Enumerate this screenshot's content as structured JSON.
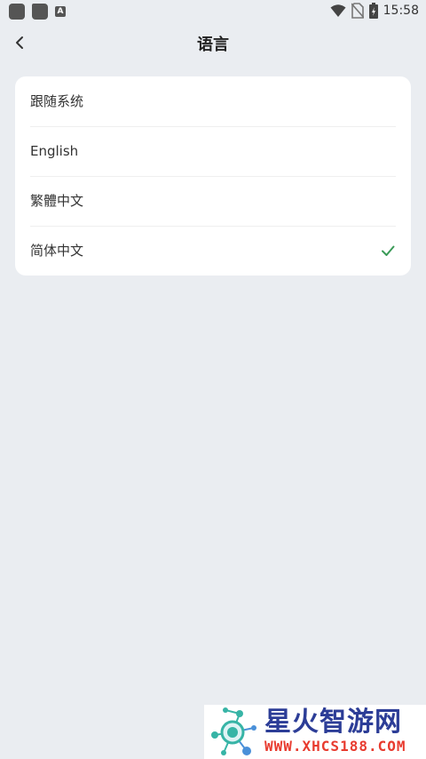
{
  "status_bar": {
    "time": "15:58",
    "left_icons": [
      "app-icon",
      "folder-icon",
      "a-icon"
    ],
    "right_icons": [
      "wifi-icon",
      "no-sim-icon",
      "battery-charging-icon"
    ]
  },
  "header": {
    "title": "语言",
    "back_icon": "chevron-left-icon"
  },
  "languages": [
    {
      "label": "跟随系统",
      "selected": false
    },
    {
      "label": "English",
      "selected": false
    },
    {
      "label": "繁體中文",
      "selected": false
    },
    {
      "label": "简体中文",
      "selected": true
    }
  ],
  "colors": {
    "background": "#eaedf1",
    "card": "#ffffff",
    "check": "#3a9a57"
  },
  "watermark": {
    "title": "星火智游网",
    "url": "WWW.XHCS188.COM"
  }
}
